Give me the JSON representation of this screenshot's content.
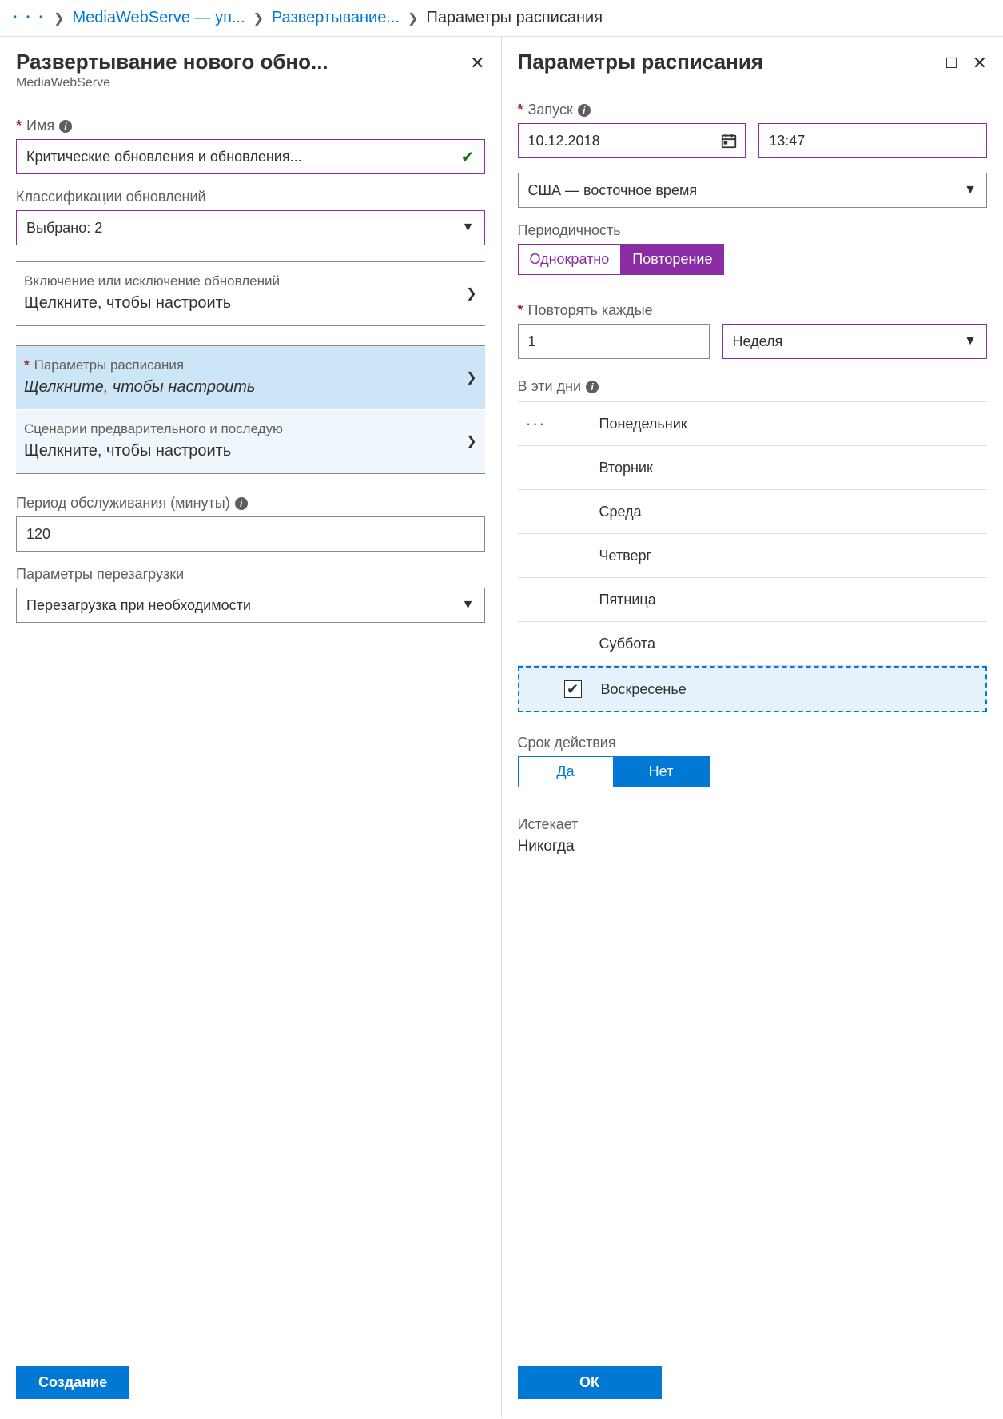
{
  "breadcrumb": {
    "dots": "· · ·",
    "item1": "MediaWebServe — уп...",
    "item2": "Развертывание...",
    "item3": "Параметры расписания"
  },
  "left": {
    "title": "Развертывание нового обно...",
    "subtitle": "MediaWebServe",
    "name_label": "Имя",
    "name_value": "Критические обновления и обновления...",
    "class_label": "Классификации обновлений",
    "class_value": "Выбрано: 2",
    "sections": {
      "inc_label": "Включение или исключение обновлений",
      "inc_value": "Щелкните, чтобы настроить",
      "sched_label": "Параметры расписания",
      "sched_value": "Щелкните, чтобы настроить",
      "scripts_label": "Сценарии предварительного и последую",
      "scripts_value": "Щелкните, чтобы настроить"
    },
    "maint_label": "Период обслуживания (минуты)",
    "maint_value": "120",
    "reboot_label": "Параметры перезагрузки",
    "reboot_value": "Перезагрузка при необходимости",
    "create_btn": "Создание"
  },
  "right": {
    "title": "Параметры расписания",
    "start_label": "Запуск",
    "start_date": "10.12.2018",
    "start_time": "13:47",
    "tz_value": "США — восточное время",
    "recur_label": "Периодичность",
    "recur_once": "Однократно",
    "recur_repeat": "Повторение",
    "every_label": "Повторять каждые",
    "every_value": "1",
    "every_unit": "Неделя",
    "days_label": "В эти дни",
    "days": {
      "mon": "Понедельник",
      "tue": "Вторник",
      "wed": "Среда",
      "thu": "Четверг",
      "fri": "Пятница",
      "sat": "Суббота",
      "sun": "Воскресенье"
    },
    "exp_label": "Срок действия",
    "exp_yes": "Да",
    "exp_no": "Нет",
    "expires_label": "Истекает",
    "expires_value": "Никогда",
    "ok_btn": "ОК"
  }
}
